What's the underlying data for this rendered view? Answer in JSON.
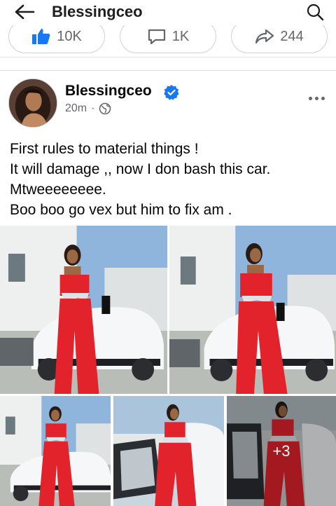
{
  "header": {
    "title": "Blessingceo",
    "back_icon": "arrow-left-icon",
    "search_icon": "search-icon"
  },
  "reactions": [
    {
      "icon": "like-icon",
      "count": "10K"
    },
    {
      "icon": "comment-icon",
      "count": "1K"
    },
    {
      "icon": "share-icon",
      "count": "244"
    }
  ],
  "post": {
    "author": "Blessingceo",
    "verified_icon": "verified-badge-icon",
    "time": "20m",
    "separator": "·",
    "audience_icon": "globe-icon",
    "more_icon": "more-options-icon",
    "text_lines": [
      "First rules to material things !",
      "It will damage ,, now I don bash this car.",
      "Mtweeeeeeee.",
      "Boo boo go vex but him to fix am ."
    ],
    "photos_more": "+3"
  },
  "colors": {
    "accent": "#1877f2",
    "secondary_text": "#65676b",
    "dress": "#e3232b"
  }
}
